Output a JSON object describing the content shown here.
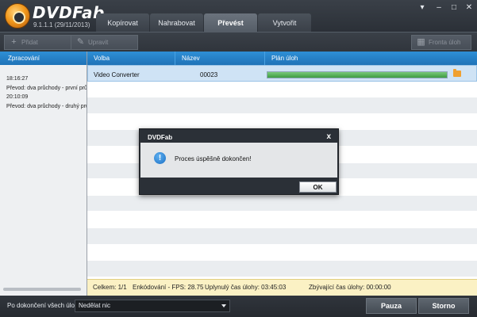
{
  "app": {
    "brand": "DVDFab",
    "version": "9.1.1.1 (29/11/2013)"
  },
  "tabs": [
    {
      "label": "Kopírovat",
      "active": false
    },
    {
      "label": "Nahrabovat",
      "active": false
    },
    {
      "label": "Převést",
      "active": true
    },
    {
      "label": "Vytvořit",
      "active": false
    }
  ],
  "toolbar": {
    "add_label": "Přidat",
    "edit_label": "Upravit",
    "queue_label": "Fronta úloh"
  },
  "left_panel": {
    "header": "Zpracování",
    "log": [
      "18:16:27",
      "Převod: dva průchody - první průc",
      "20:10:09",
      "Převod: dva průchody - druhý průc"
    ]
  },
  "table": {
    "columns": [
      "Volba",
      "Název",
      "Plán úloh"
    ],
    "rows": [
      {
        "option": "Video Converter",
        "name": "00023",
        "progress": 1.0
      }
    ]
  },
  "status": {
    "total": "Celkem: 1/1",
    "fps": "Enkódování - FPS: 28.75",
    "elapsed": "Uplynulý čas úlohy: 03:45:03",
    "remaining": "Zbývající čas úlohy: 00:00:00"
  },
  "bottom": {
    "after_label": "Po dokončení všech úloh:",
    "after_value": "Nedělat nic",
    "pause_label": "Pauza",
    "stop_label": "Storno"
  },
  "dialog": {
    "title": "DVDFab",
    "close": "x",
    "message": "Proces úspěšně dokončen!",
    "ok_label": "OK"
  },
  "colors": {
    "accent_blue": "#1f73b8",
    "progress_green": "#3f9c42",
    "status_bg": "#fbf1c4"
  }
}
